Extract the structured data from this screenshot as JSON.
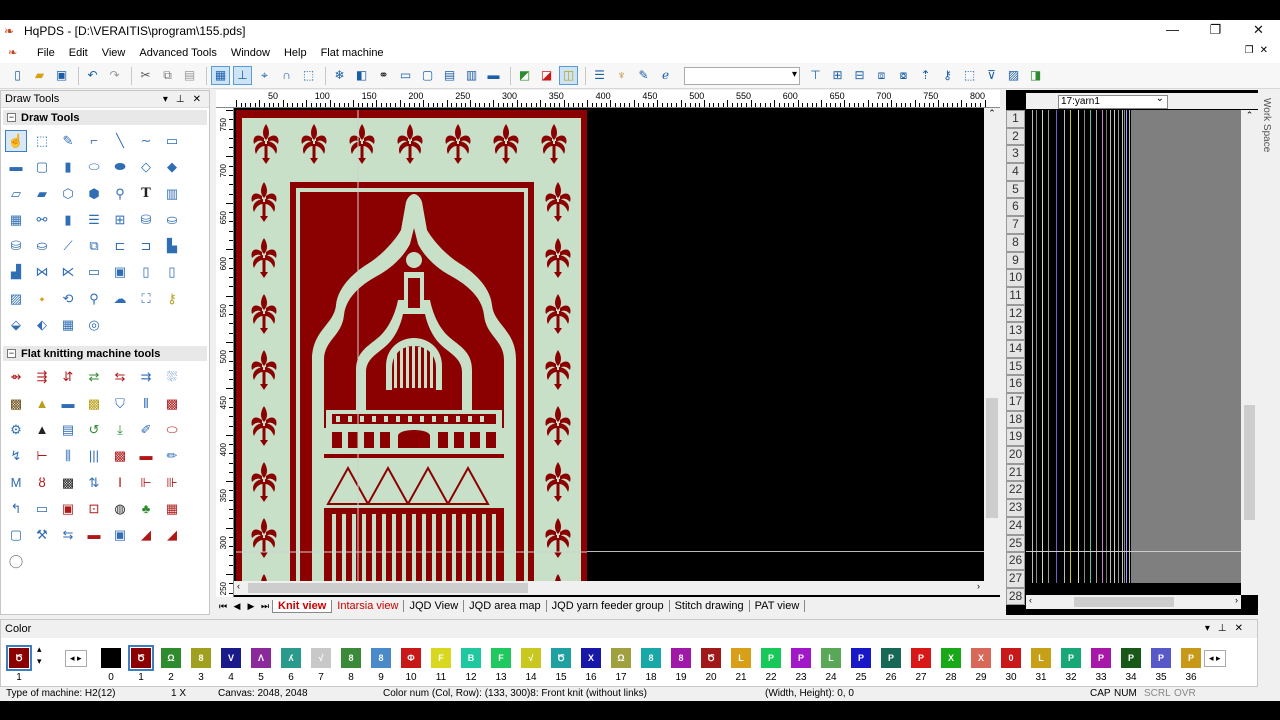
{
  "window": {
    "title": "HqPDS - [D:\\VERAITIS\\program\\155.pds]"
  },
  "menu": [
    "File",
    "Edit",
    "View",
    "Advanced Tools",
    "Window",
    "Help",
    "Flat machine"
  ],
  "draw_panel": {
    "title": "Draw Tools",
    "section1": "Draw Tools",
    "section2": "Flat knitting machine tools"
  },
  "ruler": {
    "h_labels": [
      "50",
      "100",
      "150",
      "200",
      "250",
      "300",
      "350",
      "400",
      "450",
      "500",
      "550",
      "600",
      "650",
      "700",
      "750",
      "800"
    ],
    "v_labels": [
      "750",
      "700",
      "650",
      "600",
      "550",
      "500",
      "450",
      "400",
      "350",
      "300",
      "250"
    ]
  },
  "tabs": [
    "Knit view",
    "Intarsia view",
    "JQD View",
    "JQD area map",
    "JQD yarn feeder group",
    "Stitch drawing",
    "PAT view"
  ],
  "yarn": {
    "selector": "17:yarn1",
    "rows": [
      "1",
      "2",
      "3",
      "4",
      "5",
      "6",
      "7",
      "8",
      "9",
      "10",
      "11",
      "12",
      "13",
      "14",
      "15",
      "16",
      "17",
      "18",
      "19",
      "20",
      "21",
      "22",
      "23",
      "24",
      "25",
      "26",
      "27",
      "28"
    ]
  },
  "workspace_label": "Work Space",
  "color_panel": {
    "title": "Color",
    "current": "1",
    "swatches": [
      {
        "n": "0",
        "c": "#000000",
        "g": ""
      },
      {
        "n": "1",
        "c": "#8b0000",
        "g": "Ծ"
      },
      {
        "n": "2",
        "c": "#2e8b2e",
        "g": "Ω"
      },
      {
        "n": "3",
        "c": "#a0a020",
        "g": "8"
      },
      {
        "n": "4",
        "c": "#1a1a8a",
        "g": "V"
      },
      {
        "n": "5",
        "c": "#8a2a9a",
        "g": "Λ"
      },
      {
        "n": "6",
        "c": "#2a9a8a",
        "g": "ʎ"
      },
      {
        "n": "7",
        "c": "#c8c8c8",
        "g": "√"
      },
      {
        "n": "8",
        "c": "#3a8a3a",
        "g": "8"
      },
      {
        "n": "9",
        "c": "#4a8ac8",
        "g": "8"
      },
      {
        "n": "10",
        "c": "#c81818",
        "g": "Φ"
      },
      {
        "n": "11",
        "c": "#d8d820",
        "g": "F"
      },
      {
        "n": "12",
        "c": "#20c8a0",
        "g": "B"
      },
      {
        "n": "13",
        "c": "#20c860",
        "g": "F"
      },
      {
        "n": "14",
        "c": "#c8c820",
        "g": "√"
      },
      {
        "n": "15",
        "c": "#20a0a0",
        "g": "Ծ"
      },
      {
        "n": "16",
        "c": "#1818a8",
        "g": "X"
      },
      {
        "n": "17",
        "c": "#a0a040",
        "g": "Ω"
      },
      {
        "n": "18",
        "c": "#18a8a8",
        "g": "8"
      },
      {
        "n": "19",
        "c": "#a018a8",
        "g": "8"
      },
      {
        "n": "20",
        "c": "#a01818",
        "g": "Ծ"
      },
      {
        "n": "21",
        "c": "#d8a018",
        "g": "L"
      },
      {
        "n": "22",
        "c": "#18c858",
        "g": "P"
      },
      {
        "n": "23",
        "c": "#a018c8",
        "g": "P"
      },
      {
        "n": "24",
        "c": "#58a858",
        "g": "L"
      },
      {
        "n": "25",
        "c": "#1818c8",
        "g": "P"
      },
      {
        "n": "26",
        "c": "#186858",
        "g": "P"
      },
      {
        "n": "27",
        "c": "#d81818",
        "g": "P"
      },
      {
        "n": "28",
        "c": "#18a818",
        "g": "X"
      },
      {
        "n": "29",
        "c": "#d86858",
        "g": "X"
      },
      {
        "n": "30",
        "c": "#c81818",
        "g": "0"
      },
      {
        "n": "31",
        "c": "#c8a018",
        "g": "L"
      },
      {
        "n": "32",
        "c": "#18a878",
        "g": "P"
      },
      {
        "n": "33",
        "c": "#a818a8",
        "g": "P"
      },
      {
        "n": "34",
        "c": "#185818",
        "g": "P"
      },
      {
        "n": "35",
        "c": "#5858c8",
        "g": "P"
      },
      {
        "n": "36",
        "c": "#c89818",
        "g": "P"
      }
    ]
  },
  "status": {
    "machine": "Type of machine: H2(12)",
    "zoom": "1 X",
    "canvas": "Canvas: 2048, 2048",
    "colornum": "Color num  (Col, Row): (133, 300)8: Front knit (without links)",
    "size": "(Width, Height): 0, 0",
    "cap": "CAP",
    "num": "NUM",
    "scrl": "SCRL",
    "ovr": "OVR"
  },
  "colors": {
    "rug_red": "#8b0000",
    "rug_mint": "#c8e0c8",
    "accent": "#3c7fc1"
  }
}
